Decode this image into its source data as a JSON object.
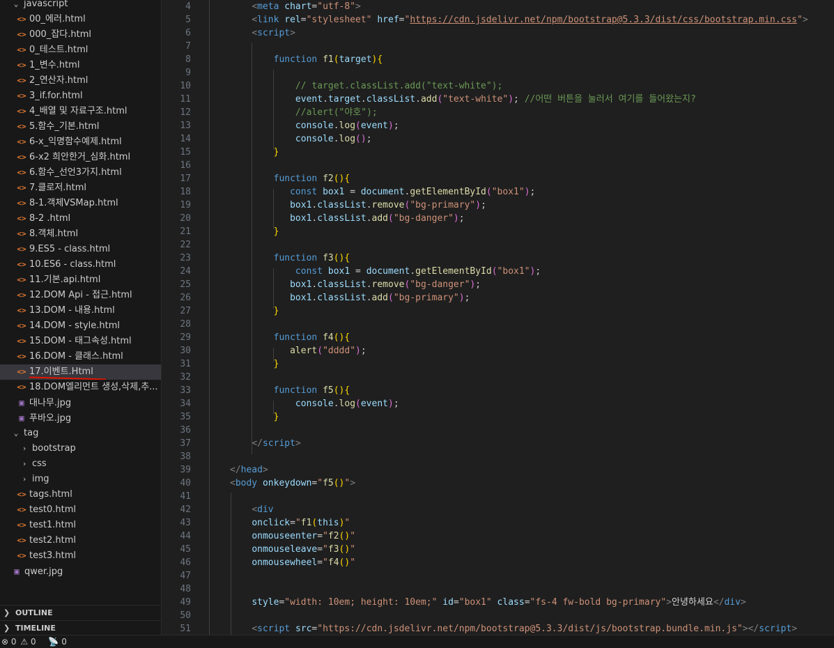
{
  "explorer": {
    "rows": [
      {
        "label": "javascript",
        "kind": "folder-open",
        "depth": 1
      },
      {
        "label": "00_에러.html",
        "kind": "html",
        "depth": 2
      },
      {
        "label": "000_잡다.html",
        "kind": "html",
        "depth": 2
      },
      {
        "label": "0_테스트.html",
        "kind": "html",
        "depth": 2
      },
      {
        "label": "1_변수.html",
        "kind": "html",
        "depth": 2
      },
      {
        "label": "2_연산자.html",
        "kind": "html",
        "depth": 2
      },
      {
        "label": "3_if.for.html",
        "kind": "html",
        "depth": 2
      },
      {
        "label": "4_배열 및 자료구조.html",
        "kind": "html",
        "depth": 2
      },
      {
        "label": "5.함수_기본.html",
        "kind": "html",
        "depth": 2
      },
      {
        "label": "6-x_익명함수예제.html",
        "kind": "html",
        "depth": 2
      },
      {
        "label": "6-x2 희안한거_심화.html",
        "kind": "html",
        "depth": 2
      },
      {
        "label": "6.함수_선언3가지.html",
        "kind": "html",
        "depth": 2
      },
      {
        "label": "7.클로저.html",
        "kind": "html",
        "depth": 2
      },
      {
        "label": "8-1.객체VSMap.html",
        "kind": "html",
        "depth": 2
      },
      {
        "label": "8-2 .html",
        "kind": "html",
        "depth": 2
      },
      {
        "label": "8.객체.html",
        "kind": "html",
        "depth": 2
      },
      {
        "label": "9.ES5 - class.html",
        "kind": "html",
        "depth": 2
      },
      {
        "label": "10.ES6 - class.html",
        "kind": "html",
        "depth": 2
      },
      {
        "label": "11.기본.api.html",
        "kind": "html",
        "depth": 2
      },
      {
        "label": "12.DOM Api - 접근.html",
        "kind": "html",
        "depth": 2
      },
      {
        "label": "13.DOM - 내용.html",
        "kind": "html",
        "depth": 2
      },
      {
        "label": "14.DOM - style.html",
        "kind": "html",
        "depth": 2
      },
      {
        "label": "15.DOM - 태그속성.html",
        "kind": "html",
        "depth": 2
      },
      {
        "label": "16.DOM - 클래스.html",
        "kind": "html",
        "depth": 2
      },
      {
        "label": "17.이벤트.Html",
        "kind": "html",
        "depth": 2,
        "selected": true
      },
      {
        "label": "18.DOM엘리먼트 생성,삭제,추...",
        "kind": "html",
        "depth": 2
      },
      {
        "label": "대나무.jpg",
        "kind": "image",
        "depth": 2
      },
      {
        "label": "푸바오.jpg",
        "kind": "image",
        "depth": 2
      },
      {
        "label": "tag",
        "kind": "folder-open",
        "depth": 1
      },
      {
        "label": "bootstrap",
        "kind": "folder-closed",
        "depth": 2
      },
      {
        "label": "css",
        "kind": "folder-closed",
        "depth": 2
      },
      {
        "label": "img",
        "kind": "folder-closed",
        "depth": 2
      },
      {
        "label": "tags.html",
        "kind": "html",
        "depth": 2
      },
      {
        "label": "test0.html",
        "kind": "html",
        "depth": 2
      },
      {
        "label": "test1.html",
        "kind": "html",
        "depth": 2
      },
      {
        "label": "test2.html",
        "kind": "html",
        "depth": 2
      },
      {
        "label": "test3.html",
        "kind": "html",
        "depth": 2
      },
      {
        "label": "qwer.jpg",
        "kind": "image",
        "depth": 1
      }
    ],
    "outline_label": "OUTLINE",
    "timeline_label": "TIMELINE"
  },
  "editor": {
    "first_line_number": 4,
    "lines": [
      [
        [
          "sp",
          "    "
        ],
        [
          "t",
          "<"
        ],
        [
          "tn",
          "meta"
        ],
        [
          "pl",
          " "
        ],
        [
          "at",
          "chart"
        ],
        [
          "pl",
          "="
        ],
        [
          "sv",
          "\"utf-8\""
        ],
        [
          "t",
          ">"
        ]
      ],
      [
        [
          "sp",
          "    "
        ],
        [
          "t",
          "<"
        ],
        [
          "tn",
          "link"
        ],
        [
          "pl",
          " "
        ],
        [
          "at",
          "rel"
        ],
        [
          "pl",
          "="
        ],
        [
          "sv",
          "\"stylesheet\""
        ],
        [
          "pl",
          " "
        ],
        [
          "at",
          "href"
        ],
        [
          "pl",
          "="
        ],
        [
          "sv",
          "\""
        ],
        [
          "svu",
          "https://cdn.jsdelivr.net/npm/bootstrap@5.3.3/dist/css/bootstrap.min.css"
        ],
        [
          "sv",
          "\""
        ],
        [
          "t",
          ">"
        ]
      ],
      [
        [
          "sp",
          "    "
        ],
        [
          "t",
          "<"
        ],
        [
          "tn",
          "script"
        ],
        [
          "t",
          ">"
        ]
      ],
      [],
      [
        [
          "sp",
          "        "
        ],
        [
          "kw",
          "function"
        ],
        [
          "pl",
          " "
        ],
        [
          "fn",
          "f1"
        ],
        [
          "br1",
          "("
        ],
        [
          "vr",
          "target"
        ],
        [
          "br1",
          ")"
        ],
        [
          "br1",
          "{"
        ]
      ],
      [],
      [
        [
          "sp",
          "            "
        ],
        [
          "cm",
          "// target.classList.add(\"text-white\");"
        ]
      ],
      [
        [
          "sp",
          "            "
        ],
        [
          "vr",
          "event"
        ],
        [
          "pl",
          "."
        ],
        [
          "vr",
          "target"
        ],
        [
          "pl",
          "."
        ],
        [
          "vr",
          "classList"
        ],
        [
          "pl",
          "."
        ],
        [
          "fn",
          "add"
        ],
        [
          "br2",
          "("
        ],
        [
          "str",
          "\"text-white\""
        ],
        [
          "br2",
          ")"
        ],
        [
          "pl",
          "; "
        ],
        [
          "cm",
          "//어떤 버튼을 눌러서 여기를 들어왔는지?"
        ]
      ],
      [
        [
          "sp",
          "            "
        ],
        [
          "cm",
          "//alert(\"야호\");"
        ]
      ],
      [
        [
          "sp",
          "            "
        ],
        [
          "vr",
          "console"
        ],
        [
          "pl",
          "."
        ],
        [
          "fn",
          "log"
        ],
        [
          "br2",
          "("
        ],
        [
          "vr",
          "event"
        ],
        [
          "br2",
          ")"
        ],
        [
          "pl",
          ";"
        ]
      ],
      [
        [
          "sp",
          "            "
        ],
        [
          "vr",
          "console"
        ],
        [
          "pl",
          "."
        ],
        [
          "fn",
          "log"
        ],
        [
          "br2",
          "()"
        ],
        [
          "pl",
          ";"
        ]
      ],
      [
        [
          "sp",
          "        "
        ],
        [
          "br1",
          "}"
        ]
      ],
      [],
      [
        [
          "sp",
          "        "
        ],
        [
          "kw",
          "function"
        ],
        [
          "pl",
          " "
        ],
        [
          "fn",
          "f2"
        ],
        [
          "br1",
          "()"
        ],
        [
          "br1",
          "{"
        ]
      ],
      [
        [
          "sp",
          "           "
        ],
        [
          "kw",
          "const"
        ],
        [
          "pl",
          " "
        ],
        [
          "vr",
          "box1"
        ],
        [
          "pl",
          " = "
        ],
        [
          "vr",
          "document"
        ],
        [
          "pl",
          "."
        ],
        [
          "fn",
          "getElementById"
        ],
        [
          "br2",
          "("
        ],
        [
          "str",
          "\"box1\""
        ],
        [
          "br2",
          ")"
        ],
        [
          "pl",
          ";"
        ]
      ],
      [
        [
          "sp",
          "           "
        ],
        [
          "vr",
          "box1"
        ],
        [
          "pl",
          "."
        ],
        [
          "vr",
          "classList"
        ],
        [
          "pl",
          "."
        ],
        [
          "fn",
          "remove"
        ],
        [
          "br2",
          "("
        ],
        [
          "str",
          "\"bg-primary\""
        ],
        [
          "br2",
          ")"
        ],
        [
          "pl",
          ";"
        ]
      ],
      [
        [
          "sp",
          "           "
        ],
        [
          "vr",
          "box1"
        ],
        [
          "pl",
          "."
        ],
        [
          "vr",
          "classList"
        ],
        [
          "pl",
          "."
        ],
        [
          "fn",
          "add"
        ],
        [
          "br2",
          "("
        ],
        [
          "str",
          "\"bg-danger\""
        ],
        [
          "br2",
          ")"
        ],
        [
          "pl",
          ";"
        ]
      ],
      [
        [
          "sp",
          "        "
        ],
        [
          "br1",
          "}"
        ]
      ],
      [],
      [
        [
          "sp",
          "        "
        ],
        [
          "kw",
          "function"
        ],
        [
          "pl",
          " "
        ],
        [
          "fn",
          "f3"
        ],
        [
          "br1",
          "()"
        ],
        [
          "br1",
          "{"
        ]
      ],
      [
        [
          "sp",
          "            "
        ],
        [
          "kw",
          "const"
        ],
        [
          "pl",
          " "
        ],
        [
          "vr",
          "box1"
        ],
        [
          "pl",
          " = "
        ],
        [
          "vr",
          "document"
        ],
        [
          "pl",
          "."
        ],
        [
          "fn",
          "getElementById"
        ],
        [
          "br2",
          "("
        ],
        [
          "str",
          "\"box1\""
        ],
        [
          "br2",
          ")"
        ],
        [
          "pl",
          ";"
        ]
      ],
      [
        [
          "sp",
          "           "
        ],
        [
          "vr",
          "box1"
        ],
        [
          "pl",
          "."
        ],
        [
          "vr",
          "classList"
        ],
        [
          "pl",
          "."
        ],
        [
          "fn",
          "remove"
        ],
        [
          "br2",
          "("
        ],
        [
          "str",
          "\"bg-danger\""
        ],
        [
          "br2",
          ")"
        ],
        [
          "pl",
          ";"
        ]
      ],
      [
        [
          "sp",
          "           "
        ],
        [
          "vr",
          "box1"
        ],
        [
          "pl",
          "."
        ],
        [
          "vr",
          "classList"
        ],
        [
          "pl",
          "."
        ],
        [
          "fn",
          "add"
        ],
        [
          "br2",
          "("
        ],
        [
          "str",
          "\"bg-primary\""
        ],
        [
          "br2",
          ")"
        ],
        [
          "pl",
          ";"
        ]
      ],
      [
        [
          "sp",
          "        "
        ],
        [
          "br1",
          "}"
        ]
      ],
      [],
      [
        [
          "sp",
          "        "
        ],
        [
          "kw",
          "function"
        ],
        [
          "pl",
          " "
        ],
        [
          "fn",
          "f4"
        ],
        [
          "br1",
          "()"
        ],
        [
          "br1",
          "{"
        ]
      ],
      [
        [
          "sp",
          "           "
        ],
        [
          "fn",
          "alert"
        ],
        [
          "br2",
          "("
        ],
        [
          "str",
          "\"dddd\""
        ],
        [
          "br2",
          ")"
        ],
        [
          "pl",
          ";"
        ]
      ],
      [
        [
          "sp",
          "        "
        ],
        [
          "br1",
          "}"
        ]
      ],
      [],
      [
        [
          "sp",
          "        "
        ],
        [
          "kw",
          "function"
        ],
        [
          "pl",
          " "
        ],
        [
          "fn",
          "f5"
        ],
        [
          "br1",
          "()"
        ],
        [
          "br1",
          "{"
        ]
      ],
      [
        [
          "sp",
          "            "
        ],
        [
          "vr",
          "console"
        ],
        [
          "pl",
          "."
        ],
        [
          "fn",
          "log"
        ],
        [
          "br2",
          "("
        ],
        [
          "vr",
          "event"
        ],
        [
          "br2",
          ")"
        ],
        [
          "pl",
          ";"
        ]
      ],
      [
        [
          "sp",
          "        "
        ],
        [
          "br1",
          "}"
        ]
      ],
      [],
      [
        [
          "sp",
          "    "
        ],
        [
          "t",
          "</"
        ],
        [
          "tn",
          "script"
        ],
        [
          "t",
          ">"
        ]
      ],
      [],
      [
        [
          "t",
          "</"
        ],
        [
          "tn",
          "head"
        ],
        [
          "t",
          ">"
        ]
      ],
      [
        [
          "t",
          "<"
        ],
        [
          "tn",
          "body"
        ],
        [
          "pl",
          " "
        ],
        [
          "at",
          "onkeydown"
        ],
        [
          "pl",
          "="
        ],
        [
          "sv",
          "\""
        ],
        [
          "fn",
          "f5"
        ],
        [
          "br1",
          "()"
        ],
        [
          "sv",
          "\""
        ],
        [
          "t",
          ">"
        ]
      ],
      [],
      [
        [
          "sp",
          "    "
        ],
        [
          "t",
          "<"
        ],
        [
          "tn",
          "div"
        ]
      ],
      [
        [
          "sp",
          "    "
        ],
        [
          "at",
          "onclick"
        ],
        [
          "pl",
          "="
        ],
        [
          "sv",
          "\""
        ],
        [
          "fn",
          "f1"
        ],
        [
          "br1",
          "("
        ],
        [
          "vr",
          "this"
        ],
        [
          "br1",
          ")"
        ],
        [
          "sv",
          "\""
        ]
      ],
      [
        [
          "sp",
          "    "
        ],
        [
          "at",
          "onmouseenter"
        ],
        [
          "pl",
          "="
        ],
        [
          "sv",
          "\""
        ],
        [
          "fn",
          "f2"
        ],
        [
          "br1",
          "()"
        ],
        [
          "sv",
          "\""
        ]
      ],
      [
        [
          "sp",
          "    "
        ],
        [
          "at",
          "onmouseleave"
        ],
        [
          "pl",
          "="
        ],
        [
          "sv",
          "\""
        ],
        [
          "fn",
          "f3"
        ],
        [
          "br1",
          "()"
        ],
        [
          "sv",
          "\""
        ]
      ],
      [
        [
          "sp",
          "    "
        ],
        [
          "at",
          "onmousewheel"
        ],
        [
          "pl",
          "="
        ],
        [
          "sv",
          "\""
        ],
        [
          "fn",
          "f4"
        ],
        [
          "br1",
          "()"
        ],
        [
          "sv",
          "\""
        ]
      ],
      [],
      [],
      [
        [
          "sp",
          "    "
        ],
        [
          "at",
          "style"
        ],
        [
          "pl",
          "="
        ],
        [
          "sv",
          "\"width: 10em; height: 10em;\""
        ],
        [
          "pl",
          " "
        ],
        [
          "at",
          "id"
        ],
        [
          "pl",
          "="
        ],
        [
          "sv",
          "\"box1\""
        ],
        [
          "pl",
          " "
        ],
        [
          "at",
          "class"
        ],
        [
          "pl",
          "="
        ],
        [
          "sv",
          "\"fs-4 fw-bold bg-primary\""
        ],
        [
          "t",
          ">"
        ],
        [
          "txt",
          "안녕하세요"
        ],
        [
          "t",
          "</"
        ],
        [
          "tn",
          "div"
        ],
        [
          "t",
          ">"
        ]
      ],
      [],
      [
        [
          "sp",
          "    "
        ],
        [
          "t",
          "<"
        ],
        [
          "tn",
          "script"
        ],
        [
          "pl",
          " "
        ],
        [
          "at",
          "src"
        ],
        [
          "pl",
          "="
        ],
        [
          "sv",
          "\"https://cdn.jsdelivr.net/npm/bootstrap@5.3.3/dist/js/bootstrap.bundle.min.js\""
        ],
        [
          "t",
          ">"
        ],
        [
          "t",
          "</"
        ],
        [
          "tn",
          "script"
        ],
        [
          "t",
          ">"
        ]
      ]
    ]
  },
  "statusbar": {
    "errors": "0",
    "warnings": "0",
    "ports": "0"
  },
  "colors": {
    "selection": "#37373d",
    "annotation_underline": "#e51400"
  }
}
